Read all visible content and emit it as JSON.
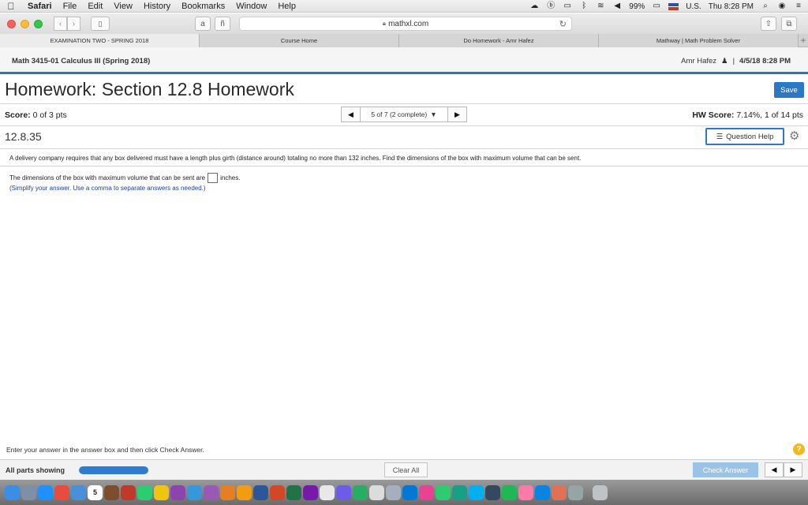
{
  "menubar": {
    "apple": "",
    "items": [
      "Safari",
      "File",
      "Edit",
      "View",
      "History",
      "Bookmarks",
      "Window",
      "Help"
    ],
    "battery": "99%",
    "input_source": "U.S.",
    "clock": "Thu 8:28 PM"
  },
  "browser": {
    "url": "mathxl.com",
    "tabs": [
      {
        "label": "EXAMINATION TWO - SPRING 2018",
        "active": true
      },
      {
        "label": "Course Home",
        "active": false
      },
      {
        "label": "Do Homework - Amr Hafez",
        "active": false
      },
      {
        "label": "Mathway | Math Problem Solver",
        "active": false
      }
    ]
  },
  "course": {
    "title": "Math 3415-01 Calculus III (Spring 2018)",
    "user": "Amr Hafez",
    "separator": "|",
    "date": "4/5/18 8:28 PM"
  },
  "homework": {
    "title": "Homework: Section 12.8 Homework",
    "save_label": "Save",
    "score_label": "Score:",
    "score_value": "0 of 3 pts",
    "question_selector": "5 of 7 (2 complete)",
    "hw_score_label": "HW Score:",
    "hw_score_value": "7.14%, 1 of 14 pts"
  },
  "question": {
    "number": "12.8.35",
    "help_label": "Question Help",
    "text": "A delivery company requires that any box delivered must have a length plus girth (distance around) totaling no more than 132 inches. Find the dimensions of the box with maximum volume that can be sent.",
    "answer_prefix": "The dimensions of the box with maximum volume that can be sent are",
    "answer_suffix": "inches.",
    "answer_value": "",
    "hint": "(Simplify your answer. Use a comma to separate answers as needed.)"
  },
  "footer": {
    "note": "Enter your answer in the answer box and then click Check Answer.",
    "help_glyph": "?",
    "parts_label": "All parts showing",
    "progress": 1.0,
    "clear_label": "Clear All",
    "check_label": "Check Answer"
  },
  "colors": {
    "accent": "#2b78c5",
    "check_disabled": "#9bc2e7",
    "hint": "#1f3f9a",
    "help_badge": "#f2b81c"
  },
  "dock": {
    "calendar_day": "5",
    "icons": [
      "finder-icon",
      "launchpad-icon",
      "safari-icon",
      "chrome-icon",
      "mail-icon",
      "calendar-icon",
      "photo-icon",
      "angry-birds-icon",
      "facetime-icon",
      "notes-icon",
      "pencil-icon",
      "preview-icon",
      "vpn-icon",
      "matlab-icon",
      "hand-icon",
      "word-icon",
      "powerpoint-icon",
      "excel-icon",
      "onenote-icon",
      "books-icon",
      "star-icon",
      "numbers-icon",
      "typography-icon",
      "photos-icon",
      "onedrive-icon",
      "pinwheel-icon",
      "messages-icon",
      "facetime2-icon",
      "skype-icon",
      "music-icon",
      "spotify-icon",
      "itunes-icon",
      "appstore-icon",
      "garage-icon",
      "settings-icon",
      "trash-icon"
    ]
  }
}
